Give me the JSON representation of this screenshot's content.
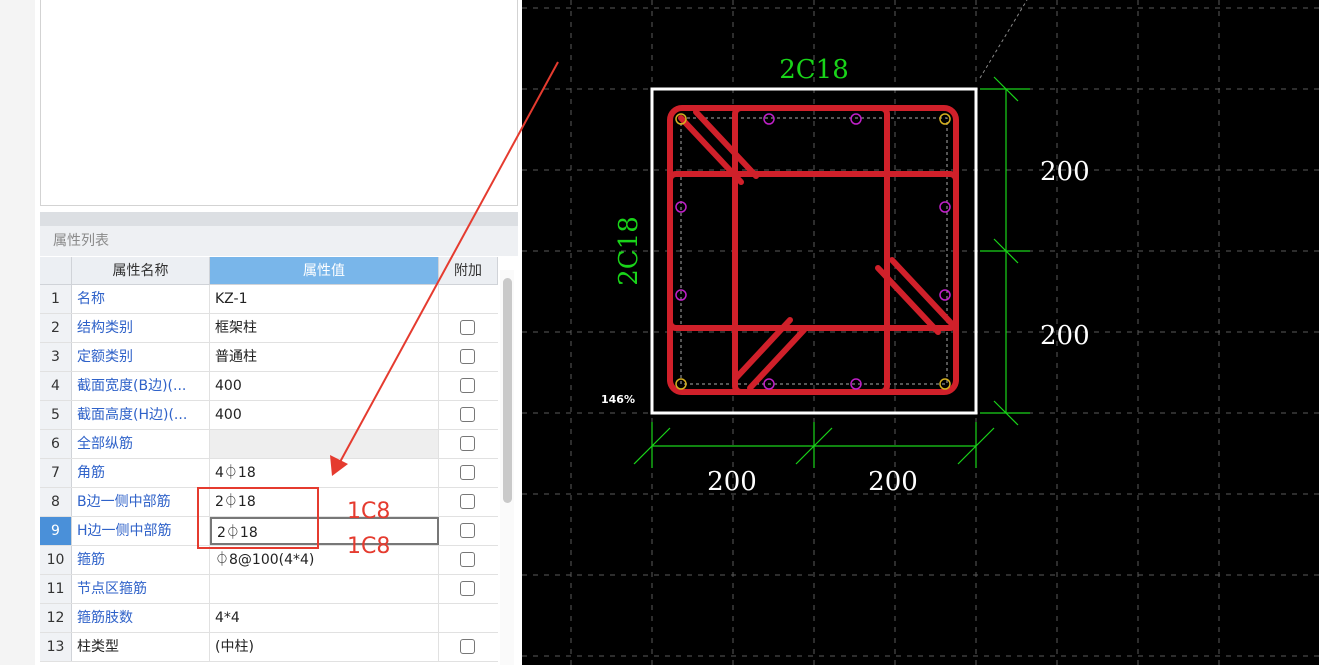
{
  "panel": {
    "title": "属性列表"
  },
  "table": {
    "headers": {
      "name": "属性名称",
      "value": "属性值",
      "extra": "附加"
    },
    "rows": [
      {
        "num": "1",
        "name": "名称",
        "value": "KZ-1",
        "checkbox": false,
        "name_color": "blue",
        "value_grey": false
      },
      {
        "num": "2",
        "name": "结构类别",
        "value": "框架柱",
        "checkbox": true,
        "name_color": "blue",
        "value_grey": false
      },
      {
        "num": "3",
        "name": "定额类别",
        "value": "普通柱",
        "checkbox": true,
        "name_color": "blue",
        "value_grey": false
      },
      {
        "num": "4",
        "name": "截面宽度(B边)(...",
        "value": "400",
        "checkbox": true,
        "name_color": "blue",
        "value_grey": false
      },
      {
        "num": "5",
        "name": "截面高度(H边)(...",
        "value": "400",
        "checkbox": true,
        "name_color": "blue",
        "value_grey": false
      },
      {
        "num": "6",
        "name": "全部纵筋",
        "value": "",
        "checkbox": true,
        "name_color": "blue",
        "value_grey": true
      },
      {
        "num": "7",
        "name": "角筋",
        "value": "4⏀18",
        "checkbox": true,
        "name_color": "blue",
        "value_grey": false
      },
      {
        "num": "8",
        "name": "B边一侧中部筋",
        "value": "2⏀18",
        "checkbox": true,
        "name_color": "blue",
        "value_grey": false
      },
      {
        "num": "9",
        "name": "H边一侧中部筋",
        "value": "2⏀18",
        "checkbox": true,
        "name_color": "blue",
        "value_grey": false,
        "active": true
      },
      {
        "num": "10",
        "name": "箍筋",
        "value": "⏀8@100(4*4)",
        "checkbox": true,
        "name_color": "blue",
        "value_grey": false
      },
      {
        "num": "11",
        "name": "节点区箍筋",
        "value": "",
        "checkbox": true,
        "name_color": "blue",
        "value_grey": false
      },
      {
        "num": "12",
        "name": "箍筋肢数",
        "value": "4*4",
        "checkbox": false,
        "name_color": "blue",
        "value_grey": false
      },
      {
        "num": "13",
        "name": "柱类型",
        "value": "(中柱)",
        "checkbox": true,
        "name_color": "black",
        "value_grey": false
      }
    ]
  },
  "annotations": {
    "note1": "1C8",
    "note2": "1C8"
  },
  "cad": {
    "top_label": "2C18",
    "left_label": "2C18",
    "dim_right_top": "200",
    "dim_right_bottom": "200",
    "dim_bottom_left": "200",
    "dim_bottom_right": "200",
    "zoom": "146%"
  },
  "colors": {
    "rebar": "#d0202a",
    "dimension": "#19d419",
    "annotation": "#e53b2f",
    "background": "#000000",
    "header_selected": "#79b6ea"
  }
}
